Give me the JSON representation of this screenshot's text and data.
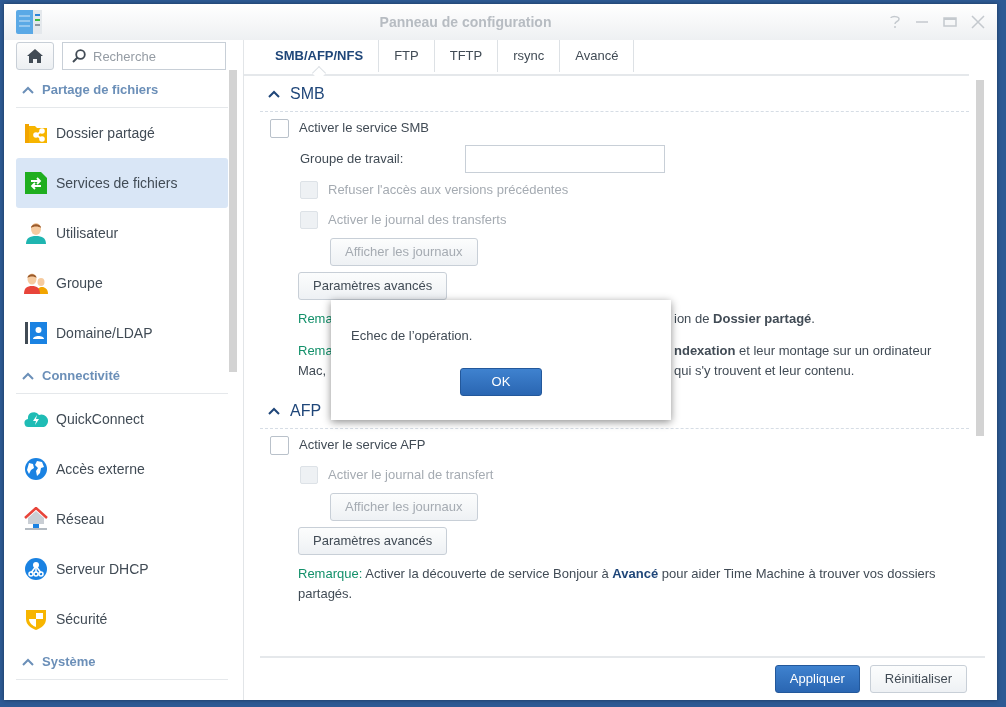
{
  "window": {
    "title": "Panneau de configuration"
  },
  "sidebar": {
    "search": {
      "placeholder": "Recherche"
    },
    "sections": [
      {
        "title": "Partage de fichiers",
        "expanded": true,
        "items": [
          {
            "label": "Dossier partagé",
            "kind": "shared-folder",
            "selected": false
          },
          {
            "label": "Services de fichiers",
            "kind": "file-services",
            "selected": true
          },
          {
            "label": "Utilisateur",
            "kind": "user",
            "selected": false
          },
          {
            "label": "Groupe",
            "kind": "group",
            "selected": false
          },
          {
            "label": "Domaine/LDAP",
            "kind": "directory",
            "selected": false
          }
        ]
      },
      {
        "title": "Connectivité",
        "expanded": true,
        "items": [
          {
            "label": "QuickConnect",
            "kind": "cloud",
            "selected": false
          },
          {
            "label": "Accès externe",
            "kind": "globe",
            "selected": false
          },
          {
            "label": "Réseau",
            "kind": "network",
            "selected": false
          },
          {
            "label": "Serveur DHCP",
            "kind": "dhcp",
            "selected": false
          },
          {
            "label": "Sécurité",
            "kind": "shield",
            "selected": false
          }
        ]
      },
      {
        "title": "Système",
        "expanded": true
      }
    ]
  },
  "tabs": [
    {
      "label": "SMB/AFP/NFS",
      "selected": true
    },
    {
      "label": "FTP",
      "selected": false
    },
    {
      "label": "TFTP",
      "selected": false
    },
    {
      "label": "rsync",
      "selected": false
    },
    {
      "label": "Avancé",
      "selected": false
    }
  ],
  "sections": [
    {
      "title": "SMB",
      "expanded": true,
      "rows": [
        {
          "kind": "checkbox",
          "label": "Activer le service SMB",
          "checked": false,
          "disabled": false,
          "children": [
            {
              "kind": "field",
              "label": "Groupe de travail:"
            },
            {
              "kind": "checkbox",
              "label": "Refuser l'accès aux versions précédentes",
              "checked": false,
              "disabled": true
            },
            {
              "kind": "checkbox",
              "label": "Activer le journal des transferts",
              "checked": false,
              "disabled": true,
              "children": [
                {
                  "kind": "button",
                  "label": "Afficher les journaux",
                  "disabled": true
                }
              ]
            }
          ]
        },
        {
          "kind": "button",
          "label": "Paramètres avancés",
          "disabled": false
        },
        {
          "kind": "covered-note",
          "lines": [
            {
              "left": "Rema",
              "left_is_label": true,
              "right": "ion de **Dossier partagé**."
            }
          ]
        },
        {
          "kind": "covered-note",
          "lines": [
            {
              "left": "Rema",
              "left_is_label": true,
              "right": "**ndexation** et leur montage sur un ordinateur"
            },
            {
              "left": "Mac,",
              "left_is_label": false,
              "right": "qui s'y trouvent et leur contenu."
            }
          ]
        }
      ]
    },
    {
      "title": "AFP",
      "expanded": true,
      "rows": [
        {
          "kind": "checkbox",
          "label": "Activer le service AFP",
          "checked": false,
          "disabled": false,
          "children": [
            {
              "kind": "checkbox",
              "label": "Activer le journal de transfert",
              "checked": false,
              "disabled": true,
              "children": [
                {
                  "kind": "button",
                  "label": "Afficher les journaux",
                  "disabled": true
                }
              ]
            }
          ]
        },
        {
          "kind": "button",
          "label": "Paramètres avancés",
          "disabled": false
        },
        {
          "kind": "note",
          "label": "Remarque:",
          "text": "Activer la découverte de service Bonjour à **Avancé** pour aider Time Machine à trouver vos dossiers partagés."
        }
      ]
    }
  ],
  "footer": {
    "buttons": [
      {
        "label": "Appliquer",
        "kind": "primary"
      },
      {
        "label": "Réinitialiser",
        "kind": "default"
      }
    ]
  },
  "dialog": {
    "message": "Echec de l’opération.",
    "button": "OK"
  }
}
